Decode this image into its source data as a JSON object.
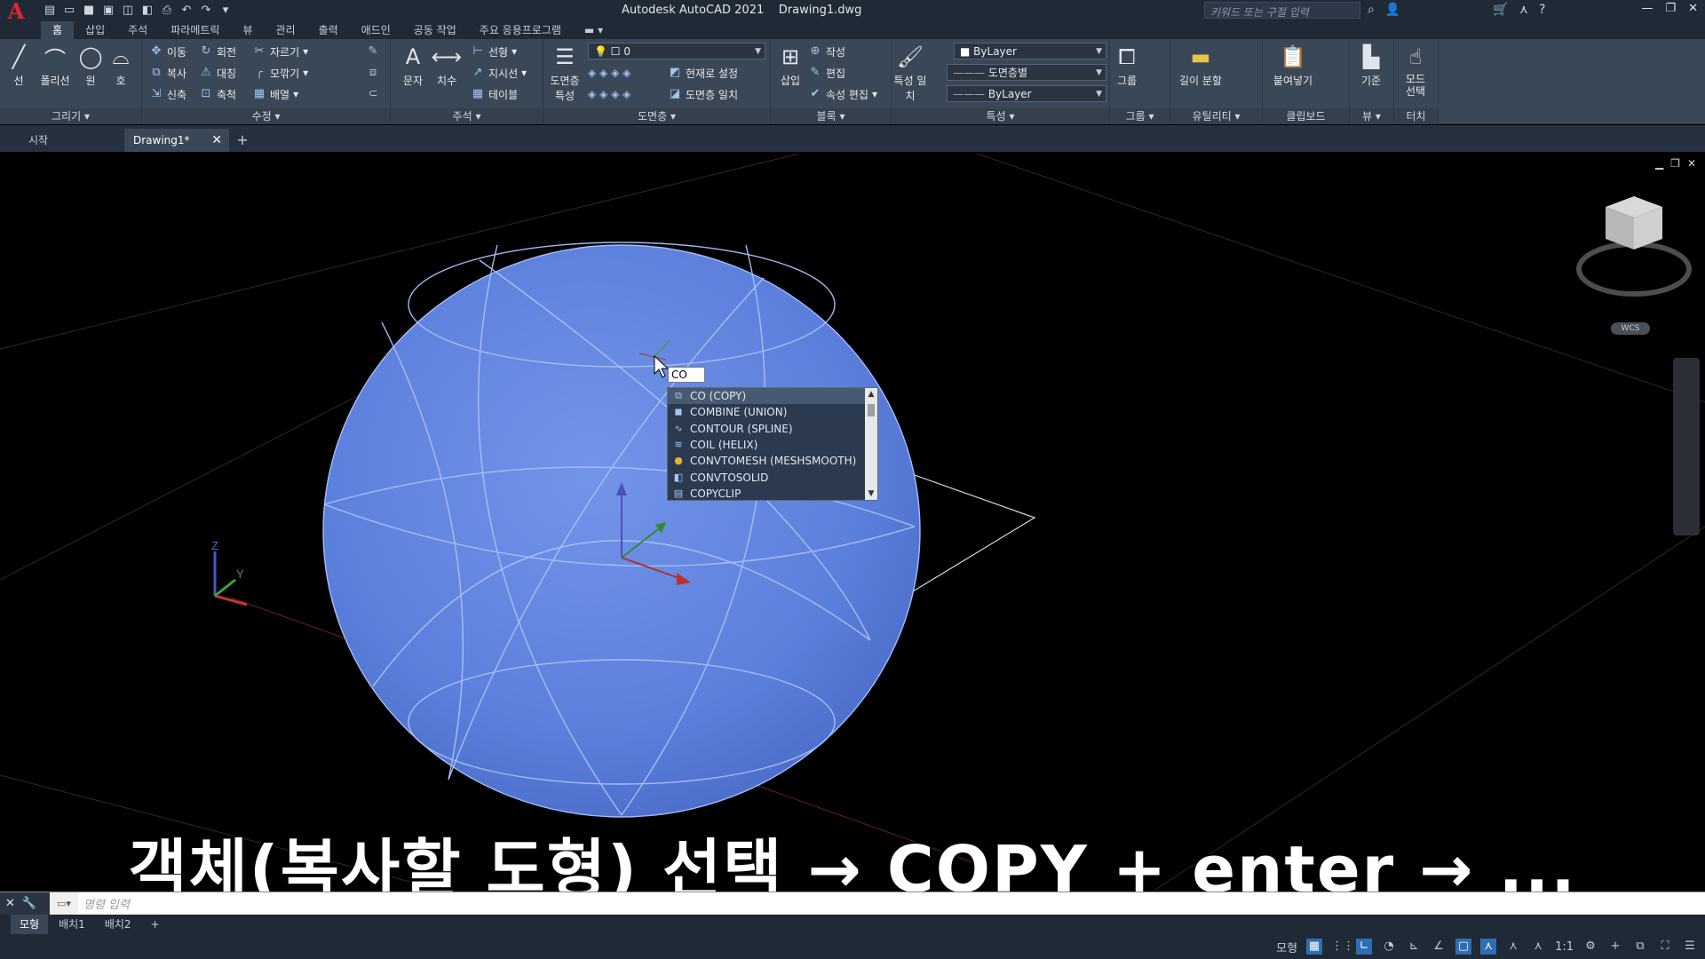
{
  "title": {
    "app": "Autodesk AutoCAD 2021",
    "file": "Drawing1.dwg",
    "search_placeholder": "키워드 또는 구절 입력"
  },
  "ribbon_tabs": [
    "홈",
    "삽입",
    "주석",
    "파라메트릭",
    "뷰",
    "관리",
    "출력",
    "애드인",
    "공동 작업",
    "주요 응용프로그램"
  ],
  "ribbon": {
    "draw": {
      "title": "그리기",
      "line": "선",
      "polyline": "폴리선",
      "circle": "원",
      "arc": "호"
    },
    "modify": {
      "title": "수정",
      "move": "이동",
      "rotate": "회전",
      "trim": "자르기",
      "copy": "복사",
      "mirror": "대칭",
      "fillet": "모깎기",
      "stretch": "신축",
      "scale": "축척",
      "array": "배열"
    },
    "annotation": {
      "title": "주석",
      "text": "문자",
      "dimension": "치수",
      "linear": "선형",
      "leader": "지시선",
      "table": "테이블"
    },
    "layers": {
      "title": "도면층",
      "properties": "도면층 특성",
      "layer_value": "0",
      "set_current": "현재로 설정",
      "match": "도면층 일치"
    },
    "block": {
      "title": "블록",
      "insert": "삽입",
      "create": "작성",
      "edit": "편집",
      "attr_edit": "속성 편집"
    },
    "properties": {
      "title": "특성",
      "match": "특성 일치",
      "color": "ByLayer",
      "linetype": "도면층별",
      "lineweight": "ByLayer"
    },
    "groups": {
      "title": "그룹",
      "group": "그룹"
    },
    "utilities": {
      "title": "유틸리티",
      "measure": "길이 분할"
    },
    "clipboard": {
      "title": "클립보드",
      "paste": "붙여넣기"
    },
    "view": {
      "title": "뷰",
      "base": "기준"
    },
    "touch": {
      "title": "터치",
      "select_mode": "모드 선택"
    }
  },
  "file_tabs": {
    "start": "시작",
    "drawing": "Drawing1*"
  },
  "viewport": {
    "wcs": "WCS",
    "ucs_z": "Z",
    "ucs_y": "Y",
    "cmd_input": "CO"
  },
  "autocomplete": [
    {
      "label": "CO (COPY)",
      "icon": "copy-icon"
    },
    {
      "label": "COMBINE (UNION)",
      "icon": "union-icon"
    },
    {
      "label": "CONTOUR (SPLINE)",
      "icon": "spline-icon"
    },
    {
      "label": "COIL (HELIX)",
      "icon": "helix-icon"
    },
    {
      "label": "CONVTOMESH (MESHSMOOTH)",
      "icon": "mesh-icon"
    },
    {
      "label": "CONVTOSOLID",
      "icon": "solid-icon"
    },
    {
      "label": "COPYCLIP",
      "icon": "clipboard-icon"
    }
  ],
  "caption": "객체(복사할 도형) 선택 → COPY + enter → ...",
  "command_line": {
    "placeholder": "명령 입력"
  },
  "layout_tabs": [
    "모형",
    "배치1",
    "배치2"
  ],
  "status": {
    "model": "모형",
    "scale": "1:1"
  },
  "colors": {
    "sphere": "#5b7fdc",
    "ribbon_bg": "#3a4756",
    "title_bg": "#1f2a36"
  }
}
